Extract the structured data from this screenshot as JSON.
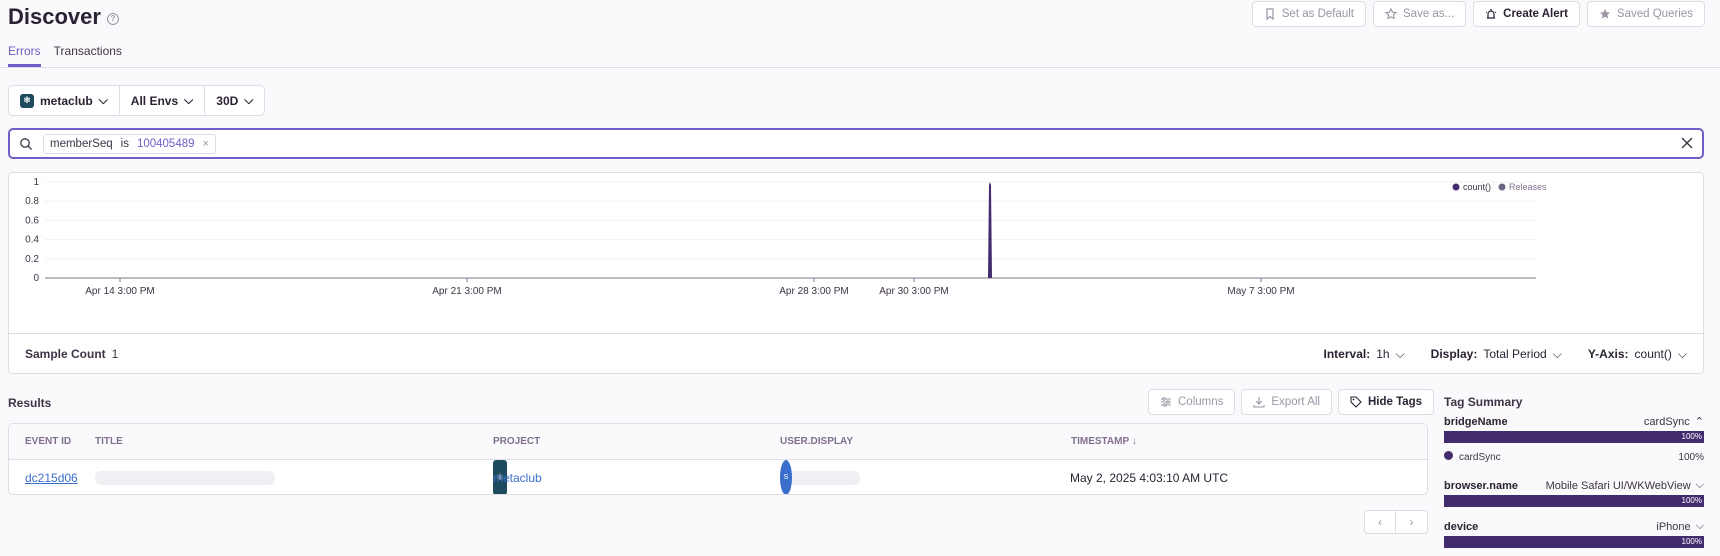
{
  "header": {
    "title": "Discover",
    "help": "?",
    "tabs": [
      {
        "label": "Errors"
      },
      {
        "label": "Transactions"
      }
    ],
    "actions": [
      {
        "label": "Set as Default",
        "icon": "bookmark-icon"
      },
      {
        "label": "Save as...",
        "icon": "star-icon"
      },
      {
        "label": "Create Alert",
        "icon": "siren-icon"
      },
      {
        "label": "Saved Queries",
        "icon": "star-filled-icon"
      }
    ]
  },
  "filters": {
    "project": "metaclub",
    "env": "All Envs",
    "period": "30D"
  },
  "search": {
    "key": "memberSeq",
    "op": "is",
    "value": "100405489",
    "remove": "×"
  },
  "chart_data": {
    "type": "area",
    "x": [
      "Apr 14 3:00 PM",
      "Apr 21 3:00 PM",
      "Apr 28 3:00 PM",
      "Apr 30 3:00 PM",
      "May 2, 2025 4:00 AM",
      "May 7 3:00 PM"
    ],
    "series": [
      {
        "name": "count()",
        "values": [
          0,
          0,
          0,
          0,
          1,
          0
        ]
      }
    ],
    "xticks": [
      "Apr 14 3:00 PM",
      "Apr 21 3:00 PM",
      "Apr 28 3:00 PM",
      "Apr 30 3:00 PM",
      "May 7 3:00 PM"
    ],
    "yticks": [
      "0",
      "0.2",
      "0.4",
      "0.6",
      "0.8",
      "1"
    ],
    "ylim": [
      0,
      1
    ],
    "legend": [
      "count()",
      "Releases"
    ],
    "legend_position": "top-right",
    "colors": {
      "series": "#422c6e",
      "releases": "#6e6680"
    }
  },
  "chart_footer": {
    "sample_label": "Sample Count",
    "sample_value": "1",
    "interval_label": "Interval:",
    "interval_value": "1h",
    "display_label": "Display:",
    "display_value": "Total Period",
    "yaxis_label": "Y-Axis:",
    "yaxis_value": "count()"
  },
  "results": {
    "title": "Results",
    "actions": {
      "columns": "Columns",
      "export": "Export All",
      "hide_tags": "Hide Tags"
    },
    "columns": [
      "EVENT ID",
      "TITLE",
      "PROJECT",
      "USER.DISPLAY",
      "TIMESTAMP ↓"
    ],
    "rows": [
      {
        "event_id": "dc215d06",
        "project": "metaclub",
        "user_badge": "S",
        "timestamp": "May 2, 2025 4:03:10 AM UTC"
      }
    ],
    "pager": {
      "prev": "‹",
      "next": "›"
    }
  },
  "tag_summary": {
    "title": "Tag Summary",
    "tags": [
      {
        "key": "bridgeName",
        "value": "cardSync",
        "percent": "100%",
        "detail": "cardSync",
        "detail_pct": "100%"
      },
      {
        "key": "browser.name",
        "value": "Mobile Safari UI/WKWebView",
        "percent": "100%"
      },
      {
        "key": "device",
        "value": "iPhone",
        "percent": "100%"
      }
    ]
  }
}
